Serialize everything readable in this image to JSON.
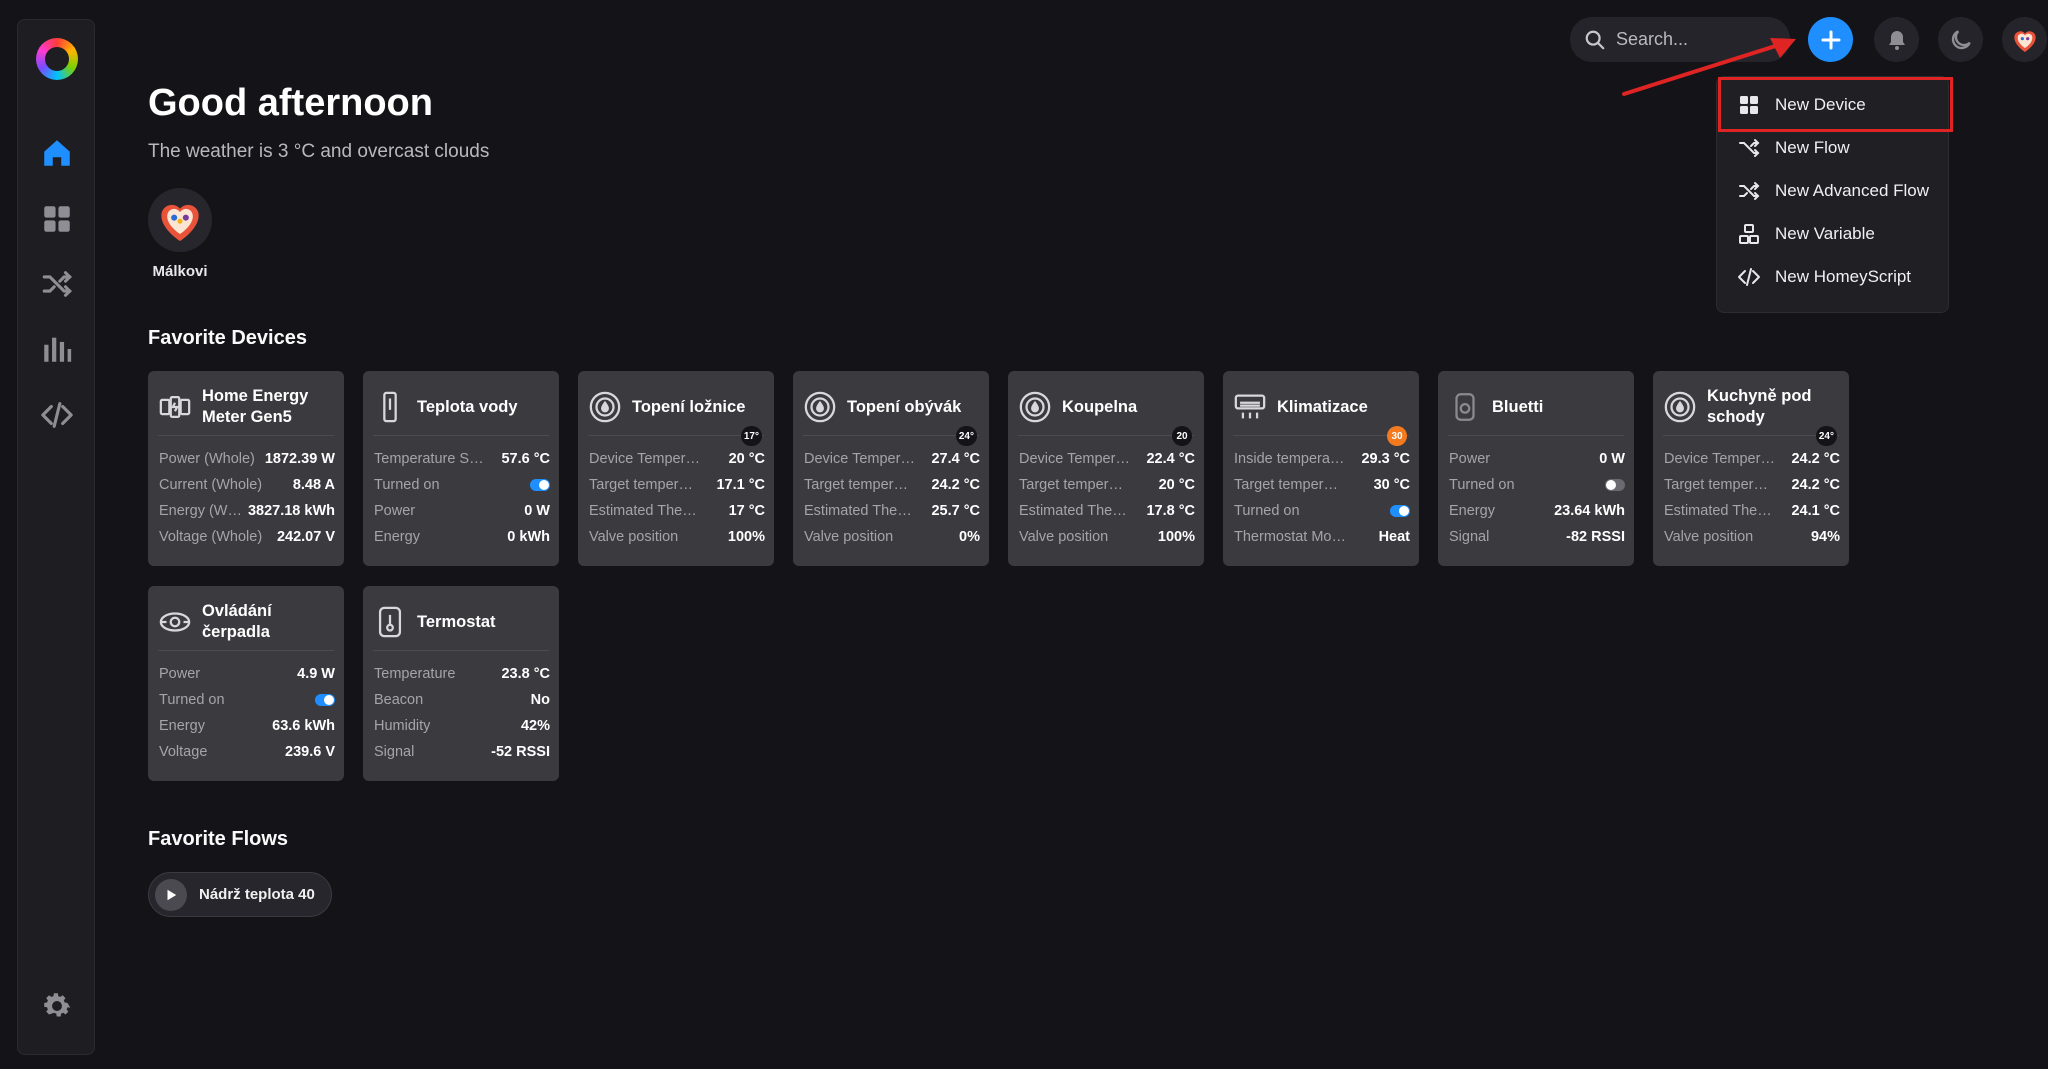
{
  "header": {
    "search_placeholder": "Search...",
    "menu": [
      {
        "label": "New Device",
        "icon": "grid-icon"
      },
      {
        "label": "New Flow",
        "icon": "flow-icon"
      },
      {
        "label": "New Advanced Flow",
        "icon": "advanced-flow-icon"
      },
      {
        "label": "New Variable",
        "icon": "variable-icon"
      },
      {
        "label": "New HomeyScript",
        "icon": "code-icon"
      }
    ]
  },
  "main": {
    "greeting": "Good afternoon",
    "weather": "The weather is 3 °C and overcast clouds",
    "user": {
      "name": "Málkovi"
    },
    "favorite_devices_title": "Favorite Devices",
    "favorite_flows_title": "Favorite Flows",
    "devices": [
      {
        "name": "Home Energy Meter Gen5",
        "icon": "energy-meter-icon",
        "rows": [
          {
            "label": "Power (Whole)",
            "value": "1872.39 W"
          },
          {
            "label": "Current (Whole)",
            "value": "8.48 A"
          },
          {
            "label": "Energy (Whole)",
            "value": "3827.18 kWh"
          },
          {
            "label": "Voltage (Whole)",
            "value": "242.07 V"
          }
        ]
      },
      {
        "name": "Teplota vody",
        "icon": "water-sensor-icon",
        "rows": [
          {
            "label": "Temperature Sensor",
            "value": "57.6 °C"
          },
          {
            "label": "Turned on",
            "toggle": "on"
          },
          {
            "label": "Power",
            "value": "0 W"
          },
          {
            "label": "Energy",
            "value": "0 kWh"
          }
        ]
      },
      {
        "name": "Topení ložnice",
        "icon": "thermostat-valve-icon",
        "badge": "17°",
        "rows": [
          {
            "label": "Device Temperature",
            "value": "20 °C"
          },
          {
            "label": "Target temperature",
            "value": "17.1 °C"
          },
          {
            "label": "Estimated Thermostat",
            "value": "17 °C"
          },
          {
            "label": "Valve position",
            "value": "100%"
          }
        ]
      },
      {
        "name": "Topení obývák",
        "icon": "thermostat-valve-icon",
        "badge": "24°",
        "rows": [
          {
            "label": "Device Temperature",
            "value": "27.4 °C"
          },
          {
            "label": "Target temperature",
            "value": "24.2 °C"
          },
          {
            "label": "Estimated Thermostat",
            "value": "25.7 °C"
          },
          {
            "label": "Valve position",
            "value": "0%"
          }
        ]
      },
      {
        "name": "Koupelna",
        "icon": "thermostat-valve-icon",
        "badge": "20",
        "rows": [
          {
            "label": "Device Temperature",
            "value": "22.4 °C"
          },
          {
            "label": "Target temperature",
            "value": "20 °C"
          },
          {
            "label": "Estimated Thermostat",
            "value": "17.8 °C"
          },
          {
            "label": "Valve position",
            "value": "100%"
          }
        ]
      },
      {
        "name": "Klimatizace",
        "icon": "air-conditioner-icon",
        "badge": "30",
        "badge_color": "#f47a20",
        "rows": [
          {
            "label": "Inside temperature",
            "value": "29.3 °C"
          },
          {
            "label": "Target temperature",
            "value": "30 °C"
          },
          {
            "label": "Turned on",
            "toggle": "on"
          },
          {
            "label": "Thermostat Mode",
            "value": "Heat"
          }
        ]
      },
      {
        "name": "Bluetti",
        "icon": "battery-station-icon",
        "rows": [
          {
            "label": "Power",
            "value": "0 W"
          },
          {
            "label": "Turned on",
            "toggle": "off"
          },
          {
            "label": "Energy",
            "value": "23.64 kWh"
          },
          {
            "label": "Signal",
            "value": "-82 RSSI"
          }
        ]
      },
      {
        "name": "Kuchyně pod schody",
        "icon": "thermostat-valve-icon",
        "badge": "24°",
        "rows": [
          {
            "label": "Device Temperature",
            "value": "24.2 °C"
          },
          {
            "label": "Target temperature",
            "value": "24.2 °C"
          },
          {
            "label": "Estimated Thermostat",
            "value": "24.1 °C"
          },
          {
            "label": "Valve position",
            "value": "94%"
          }
        ]
      },
      {
        "name": "Ovládání čerpadla",
        "icon": "pump-icon",
        "rows": [
          {
            "label": "Power",
            "value": "4.9 W"
          },
          {
            "label": "Turned on",
            "toggle": "on"
          },
          {
            "label": "Energy",
            "value": "63.6 kWh"
          },
          {
            "label": "Voltage",
            "value": "239.6 V"
          }
        ]
      },
      {
        "name": "Termostat",
        "icon": "thermostat-icon",
        "rows": [
          {
            "label": "Temperature",
            "value": "23.8 °C"
          },
          {
            "label": "Beacon",
            "value": "No"
          },
          {
            "label": "Humidity",
            "value": "42%"
          },
          {
            "label": "Signal",
            "value": "-52 RSSI"
          }
        ]
      }
    ],
    "flows": [
      {
        "label": "Nádrž teplota 40"
      }
    ]
  },
  "colors": {
    "accent": "#1f8fff",
    "highlight": "#e02424",
    "badge_orange": "#f47a20"
  }
}
